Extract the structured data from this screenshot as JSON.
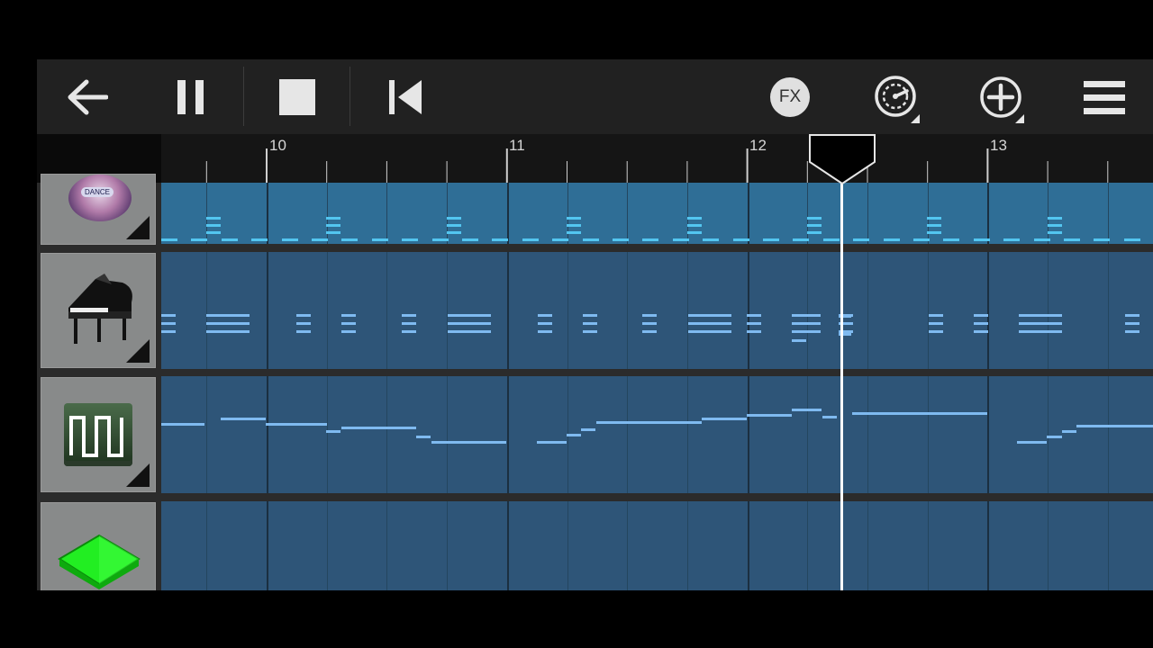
{
  "toolbar": {
    "back_icon": "arrow-left-icon",
    "pause_icon": "pause-icon",
    "stop_icon": "stop-icon",
    "rewind_icon": "skip-to-start-icon",
    "fx_label": "FX",
    "tempo_icon": "metronome-gauge-icon",
    "add_icon": "plus-circle-icon",
    "menu_icon": "hamburger-menu-icon"
  },
  "ruler": {
    "bars": [
      "10",
      "11",
      "12",
      "13"
    ]
  },
  "tracks": [
    {
      "name": "drums",
      "instrument_icon": "dance-kit-icon",
      "badge_text": "DANCE"
    },
    {
      "name": "piano",
      "instrument_icon": "grand-piano-icon"
    },
    {
      "name": "synth-square",
      "instrument_icon": "square-wave-synth-icon"
    },
    {
      "name": "synth-pad",
      "instrument_icon": "green-gem-icon"
    }
  ],
  "colors": {
    "background": "#000000",
    "toolbar": "#212121",
    "lane": "#2e5578",
    "lane_selected": "#2f6e96",
    "note": "#7fbaf0",
    "playhead": "#ffffff"
  }
}
